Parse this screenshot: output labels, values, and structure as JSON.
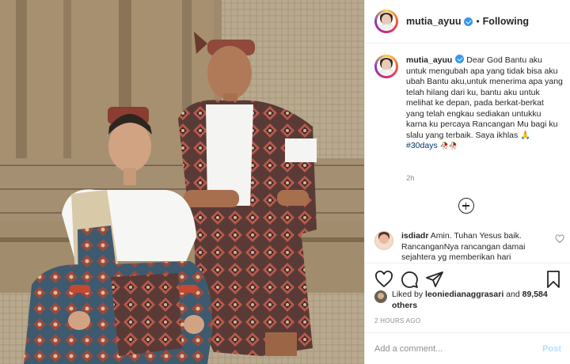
{
  "post": {
    "username": "mutia_ayuu",
    "follow_status": "Following",
    "separator": "•"
  },
  "caption": {
    "username": "mutia_ayuu",
    "text": "Dear God Bantu aku untuk mengubah apa yang tidak bisa aku ubah Bantu aku,untuk menerima apa yang telah hilang dari ku, bantu aku untuk melihat ke depan, pada berkat-berkat yang telah engkau sediakan untukku karna ku percaya Rancangan Mu bagi ku slalu yang terbaik. Saya ikhlas 🙏",
    "hashtag": "#30days",
    "emoji_suffix": "🥀🥀",
    "time_ago": "2h"
  },
  "comment": {
    "username": "isdiadr",
    "text": "Amin. Tuhan Yesus baik. RancanganNya rancangan damai sejahtera yg memberikan hari"
  },
  "likes": {
    "prefix": "Liked by",
    "liker": "leoniedianaggrasari",
    "and": "and",
    "others": "89,584 others"
  },
  "date": "2 HOURS AGO",
  "add_comment": {
    "placeholder": "Add a comment...",
    "post_label": "Post"
  },
  "icons": {
    "like": "heart-icon",
    "comment": "comment-icon",
    "share": "share-icon",
    "save": "bookmark-icon",
    "load_more": "plus-circle-icon"
  },
  "colors": {
    "verified": "#3897f0",
    "hashtag": "#00376b",
    "post_button": "#b2dffc",
    "muted": "#8e8e8e"
  }
}
